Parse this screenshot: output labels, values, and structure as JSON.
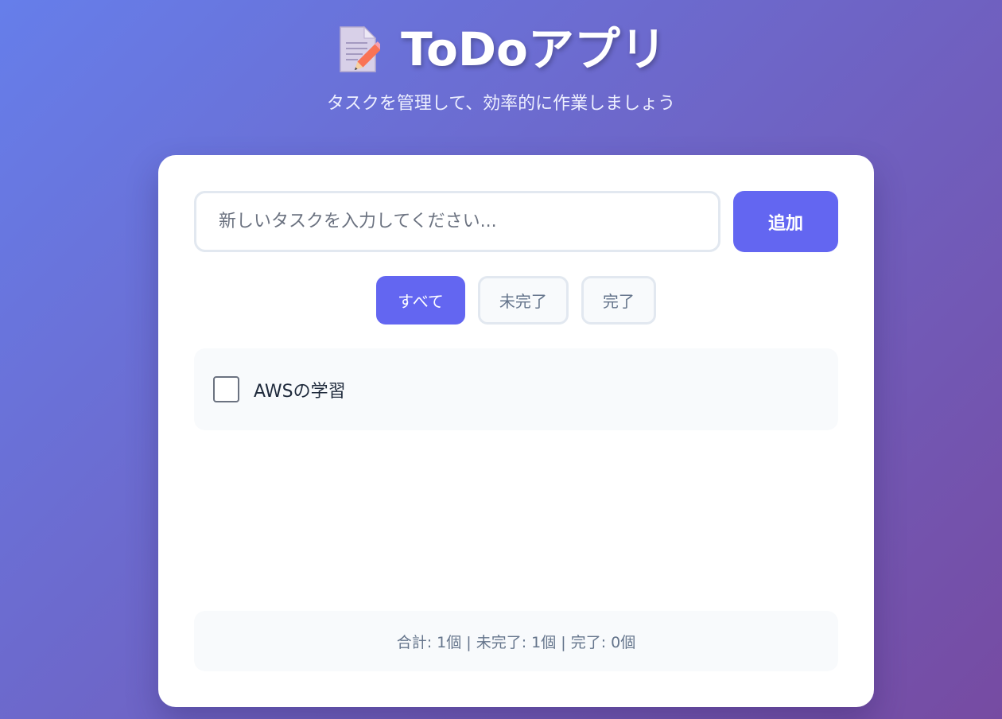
{
  "header": {
    "icon": "memo-icon",
    "title": "ToDoアプリ",
    "subtitle": "タスクを管理して、効率的に作業しましょう"
  },
  "input": {
    "placeholder": "新しいタスクを入力してください...",
    "value": ""
  },
  "add_button": {
    "label": "追加"
  },
  "filters": [
    {
      "label": "すべて",
      "active": true
    },
    {
      "label": "未完了",
      "active": false
    },
    {
      "label": "完了",
      "active": false
    }
  ],
  "todos": [
    {
      "text": "AWSの学習",
      "completed": false
    }
  ],
  "stats": {
    "text": "合計: 1個 | 未完了: 1個 | 完了: 0個"
  },
  "colors": {
    "background_start": "#667eea",
    "background_end": "#764ba2",
    "accent": "#6366f1",
    "card": "#ffffff",
    "muted": "#64748b"
  }
}
